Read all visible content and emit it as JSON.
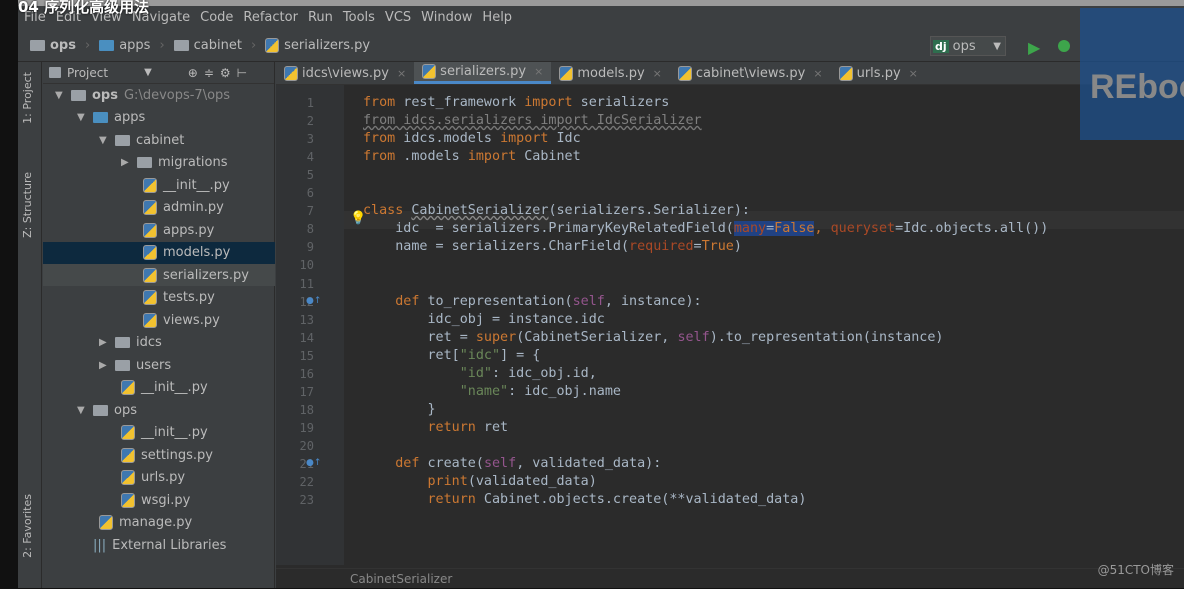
{
  "video_title": "04 序列化高级用法",
  "menu": [
    "File",
    "Edit",
    "View",
    "Navigate",
    "Code",
    "Refactor",
    "Run",
    "Tools",
    "VCS",
    "Window",
    "Help"
  ],
  "breadcrumb": [
    "ops",
    "apps",
    "cabinet",
    "serializers.py"
  ],
  "run_config": "ops",
  "watermark_logo": "REboot",
  "left_tabs": [
    "1: Project",
    "Z: Structure",
    "2: Favorites"
  ],
  "project_panel": {
    "title": "Project"
  },
  "tree": [
    {
      "label": "ops",
      "extra": "G:\\devops-7\\ops",
      "depth": 0,
      "type": "folder",
      "open": true
    },
    {
      "label": "apps",
      "depth": 1,
      "type": "folder-blue",
      "open": true
    },
    {
      "label": "cabinet",
      "depth": 2,
      "type": "folder",
      "open": true
    },
    {
      "label": "migrations",
      "depth": 3,
      "type": "folder",
      "open": false
    },
    {
      "label": "__init__.py",
      "depth": 4,
      "type": "py"
    },
    {
      "label": "admin.py",
      "depth": 4,
      "type": "py"
    },
    {
      "label": "apps.py",
      "depth": 4,
      "type": "py"
    },
    {
      "label": "models.py",
      "depth": 4,
      "type": "py",
      "state": "sel"
    },
    {
      "label": "serializers.py",
      "depth": 4,
      "type": "py",
      "state": "hl"
    },
    {
      "label": "tests.py",
      "depth": 4,
      "type": "py"
    },
    {
      "label": "views.py",
      "depth": 4,
      "type": "py"
    },
    {
      "label": "idcs",
      "depth": 2,
      "type": "folder",
      "open": false
    },
    {
      "label": "users",
      "depth": 2,
      "type": "folder",
      "open": false
    },
    {
      "label": "__init__.py",
      "depth": 3,
      "type": "py"
    },
    {
      "label": "ops",
      "depth": 1,
      "type": "folder",
      "open": true
    },
    {
      "label": "__init__.py",
      "depth": 3,
      "type": "py"
    },
    {
      "label": "settings.py",
      "depth": 3,
      "type": "py"
    },
    {
      "label": "urls.py",
      "depth": 3,
      "type": "py"
    },
    {
      "label": "wsgi.py",
      "depth": 3,
      "type": "py"
    },
    {
      "label": "manage.py",
      "depth": 2,
      "type": "py"
    },
    {
      "label": "External Libraries",
      "depth": 1,
      "type": "lib"
    }
  ],
  "tabs": [
    {
      "label": "idcs\\views.py",
      "active": false
    },
    {
      "label": "serializers.py",
      "active": true
    },
    {
      "label": "models.py",
      "active": false
    },
    {
      "label": "cabinet\\views.py",
      "active": false
    },
    {
      "label": "urls.py",
      "active": false
    }
  ],
  "code": [
    [
      [
        "from",
        "kw"
      ],
      [
        " rest_framework ",
        ""
      ],
      [
        "import",
        "kw"
      ],
      [
        " serializers",
        ""
      ]
    ],
    [
      [
        "from idcs.serializers import IdcSerializer",
        "dim ul"
      ]
    ],
    [
      [
        "from",
        "kw"
      ],
      [
        " idcs.models ",
        ""
      ],
      [
        "import",
        "kw"
      ],
      [
        " Idc",
        ""
      ]
    ],
    [
      [
        "from",
        "kw"
      ],
      [
        " .models ",
        ""
      ],
      [
        "import",
        "kw"
      ],
      [
        " Cabinet",
        ""
      ]
    ],
    [],
    [],
    [
      [
        "class",
        "kw"
      ],
      [
        " ",
        ""
      ],
      [
        "CabinetSerializer",
        "wv"
      ],
      [
        "(serializers.Serializer):",
        ""
      ]
    ],
    [
      [
        "    idc  = serializers.PrimaryKeyRelatedField(",
        ""
      ],
      [
        "many",
        "prm sel"
      ],
      [
        "=",
        "sel"
      ],
      [
        "False",
        "kw sel"
      ],
      [
        ", ",
        "kw"
      ],
      [
        "queryset",
        "prm"
      ],
      [
        "=Idc.objects.all())",
        ""
      ]
    ],
    [
      [
        "    name = serializers.CharField(",
        ""
      ],
      [
        "required",
        "prm"
      ],
      [
        "=",
        ""
      ],
      [
        "True",
        "kw"
      ],
      [
        ")",
        ""
      ]
    ],
    [],
    [],
    [
      [
        "    ",
        ""
      ],
      [
        "def",
        "kw"
      ],
      [
        " to_representation(",
        ""
      ],
      [
        "self",
        "slf"
      ],
      [
        ", instance):",
        ""
      ]
    ],
    [
      [
        "        idc_obj = instance.idc",
        ""
      ]
    ],
    [
      [
        "        ret = ",
        ""
      ],
      [
        "super",
        "kw"
      ],
      [
        "(CabinetSerializer, ",
        ""
      ],
      [
        "self",
        "slf"
      ],
      [
        ").to_representation(instance)",
        ""
      ]
    ],
    [
      [
        "        ret[",
        ""
      ],
      [
        "\"idc\"",
        "str"
      ],
      [
        "] = {",
        ""
      ]
    ],
    [
      [
        "            ",
        ""
      ],
      [
        "\"id\"",
        "str"
      ],
      [
        ": idc_obj.id,",
        ""
      ]
    ],
    [
      [
        "            ",
        ""
      ],
      [
        "\"name\"",
        "str"
      ],
      [
        ": idc_obj.name",
        ""
      ]
    ],
    [
      [
        "        }",
        ""
      ]
    ],
    [
      [
        "        ",
        ""
      ],
      [
        "return",
        "kw"
      ],
      [
        " ret",
        ""
      ]
    ],
    [],
    [
      [
        "    ",
        ""
      ],
      [
        "def",
        "kw"
      ],
      [
        " create(",
        ""
      ],
      [
        "self",
        "slf"
      ],
      [
        ", validated_data):",
        ""
      ]
    ],
    [
      [
        "        ",
        ""
      ],
      [
        "print",
        "kw"
      ],
      [
        "(validated_data)",
        ""
      ]
    ],
    [
      [
        "        ",
        ""
      ],
      [
        "return",
        "kw"
      ],
      [
        " Cabinet.objects.create(**validated_data)",
        ""
      ]
    ]
  ],
  "status_breadcrumb": "CabinetSerializer",
  "corner_watermark": "@51CTO博客"
}
